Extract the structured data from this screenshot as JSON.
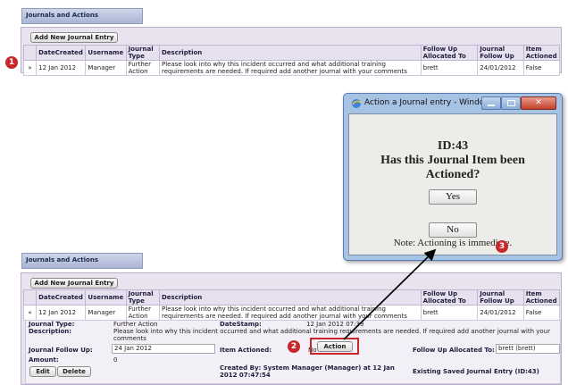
{
  "section_title": "Journals and Actions",
  "add_button": "Add New Journal Entry",
  "columns": [
    "DateCreated",
    "Username",
    "Journal Type",
    "Description",
    "Follow Up Allocated To",
    "Journal Follow Up",
    "Item Actioned"
  ],
  "row": {
    "expand_collapsed": "»",
    "expand_open": "«",
    "date": "12 Jan 2012",
    "user": "Manager",
    "type": "Further Action",
    "description": "Please look into why this incident occurred and what additional training requirements are needed. If required add another journal with your comments",
    "allocated": "brett",
    "followup": "24/01/2012",
    "actioned": "False"
  },
  "badges": [
    "1",
    "2",
    "3"
  ],
  "dialog": {
    "title": "Action a Journal entry - Window...",
    "id_line": "ID:43",
    "question": "Has this Journal Item been Actioned?",
    "yes": "Yes",
    "no": "No",
    "note": "Note: Actioning is immediate."
  },
  "detail": {
    "journal_type_label": "Journal Type:",
    "journal_type": "Further Action",
    "datestamp_label": "DateStamp:",
    "datestamp": "12 Jan 2012 07:39",
    "description_label": "Description:",
    "description": "Please look into why this incident occurred and what additional training requirements are needed. If required add another journal with your comments",
    "followup_label": "Journal Follow Up:",
    "followup": "24 Jan 2012",
    "item_actioned_label": "Item Actioned:",
    "item_actioned": "No",
    "action_button": "Action",
    "allocated_label": "Follow Up Allocated To:",
    "allocated": "brett (brett)",
    "amount_label": "Amount:",
    "amount": "0",
    "edit": "Edit",
    "delete": "Delete",
    "created_by": "Created By: System Manager (Manager) at 12 Jan 2012 07:47:54",
    "existing": "Existing Saved Journal Entry (ID:43)"
  },
  "colors": {
    "badge": "#c8282c",
    "highlight": "#c8282c",
    "panel": "#e9e3f0",
    "dialog_frame": "#a7c3e4"
  }
}
